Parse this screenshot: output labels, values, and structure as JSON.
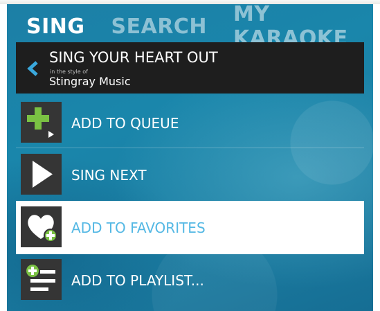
{
  "tabs": [
    {
      "label": "SING",
      "active": true
    },
    {
      "label": "SEARCH",
      "active": false
    },
    {
      "label": "MY KARAOKE",
      "active": false
    }
  ],
  "song": {
    "title": "SING YOUR HEART OUT",
    "style_of_label": "in the style of",
    "artist": "Stingray Music"
  },
  "actions": [
    {
      "label": "ADD TO QUEUE",
      "icon": "add-to-queue-icon"
    },
    {
      "label": "SING NEXT",
      "icon": "play-icon"
    },
    {
      "label": "ADD TO FAVORITES",
      "icon": "heart-add-icon",
      "highlighted": true
    },
    {
      "label": "ADD TO PLAYLIST...",
      "icon": "playlist-add-icon"
    }
  ],
  "colors": {
    "background": "#1b7ea3",
    "header_bg": "#1e1e1e",
    "tile_bg": "#353535",
    "accent_green": "#7ac143",
    "accent_cyan": "#54b8e4",
    "tab_inactive": "#9ccde0"
  }
}
